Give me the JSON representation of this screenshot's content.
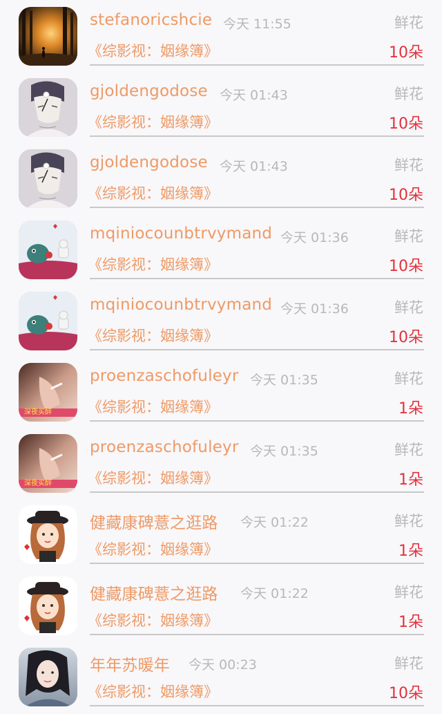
{
  "entries": [
    {
      "username": "stefanoricshcie",
      "time": "今天 11:55",
      "gift_type": "鲜花",
      "book_title": "《综影视：姻缘簿》",
      "count": "10朵",
      "avatar_icon": "forest-sunset-avatar-icon"
    },
    {
      "username": "gjoldengodose",
      "time": "今天 01:43",
      "gift_type": "鲜花",
      "book_title": "《综影视：姻缘簿》",
      "count": "10朵",
      "avatar_icon": "anime-boy-flower-avatar-icon"
    },
    {
      "username": "gjoldengodose",
      "time": "今天 01:43",
      "gift_type": "鲜花",
      "book_title": "《综影视：姻缘簿》",
      "count": "10朵",
      "avatar_icon": "anime-boy-flower-avatar-icon"
    },
    {
      "username": "mqiniocounbtrvymand",
      "time": "今天 01:36",
      "gift_type": "鲜花",
      "book_title": "《综影视：姻缘簿》",
      "count": "10朵",
      "avatar_icon": "cartoon-dinosaur-avatar-icon"
    },
    {
      "username": "mqiniocounbtrvymand",
      "time": "今天 01:36",
      "gift_type": "鲜花",
      "book_title": "《综影视：姻缘簿》",
      "count": "10朵",
      "avatar_icon": "cartoon-dinosaur-avatar-icon"
    },
    {
      "username": "proenzaschofuleyr",
      "time": "今天 01:35",
      "gift_type": "鲜花",
      "book_title": "《综影视：姻缘簿》",
      "count": "1朵",
      "avatar_icon": "photo-smoking-avatar-icon"
    },
    {
      "username": "proenzaschofuleyr",
      "time": "今天 01:35",
      "gift_type": "鲜花",
      "book_title": "《综影视：姻缘簿》",
      "count": "1朵",
      "avatar_icon": "photo-smoking-avatar-icon"
    },
    {
      "username": "健藏康碑薏之逛路",
      "time": "今天 01:22",
      "gift_type": "鲜花",
      "book_title": "《综影视：姻缘簿》",
      "count": "1朵",
      "avatar_icon": "cartoon-girl-hat-avatar-icon"
    },
    {
      "username": "健藏康碑薏之逛路",
      "time": "今天 01:22",
      "gift_type": "鲜花",
      "book_title": "《综影视：姻缘簿》",
      "count": "1朵",
      "avatar_icon": "cartoon-girl-hat-avatar-icon"
    },
    {
      "username": "年年苏暖年",
      "time": "今天 00:23",
      "gift_type": "鲜花",
      "book_title": "《综影视：姻缘簿》",
      "count": "10朵",
      "avatar_icon": "photo-woman-avatar-icon"
    }
  ],
  "avatar_badge_text": "深夜买醉"
}
